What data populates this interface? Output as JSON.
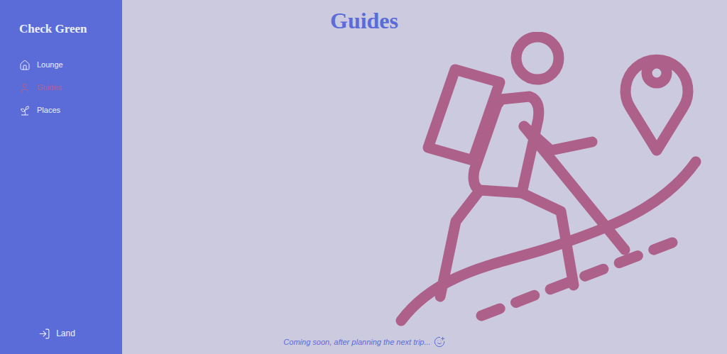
{
  "sidebar": {
    "brand": "Check Green",
    "items": [
      {
        "label": "Lounge",
        "selected": false
      },
      {
        "label": "Guides",
        "selected": true
      },
      {
        "label": "Places",
        "selected": false
      }
    ],
    "footer_action": "Land"
  },
  "page": {
    "title": "Guides",
    "footer_note": "Coming soon, after planning the next trip..."
  }
}
